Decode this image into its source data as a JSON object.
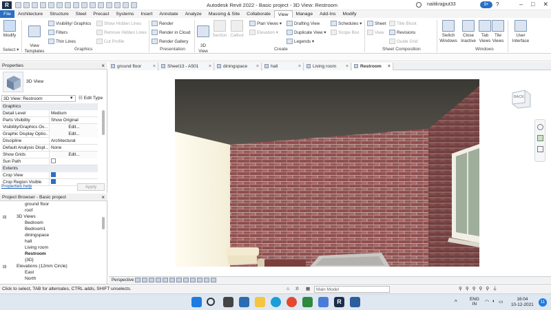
{
  "app": {
    "title": "Autodesk Revit 2022 - Basic project - 3D View: Restroom",
    "user": "naitikrajput33",
    "badge": "9+",
    "logo_letter": "R"
  },
  "ribbon_tabs": [
    "File",
    "Architecture",
    "Structure",
    "Steel",
    "Precast",
    "Systems",
    "Insert",
    "Annotate",
    "Analyze",
    "Massing & Site",
    "Collaborate",
    "View",
    "Manage",
    "Add-Ins",
    "Modify"
  ],
  "active_tab": "View",
  "ribbon": {
    "modify": "Modify",
    "select": "Select ▾",
    "view_templates": "View\nTemplates",
    "visibility_graphics": "Visibility/ Graphics",
    "filters": "Filters",
    "thin_lines": "Thin Lines",
    "show_hidden_lines": "Show Hidden Lines",
    "remove_hidden_lines": "Remove Hidden Lines",
    "cut_profile": "Cut Profile",
    "graphics_label": "Graphics",
    "render": "Render",
    "render_cloud": "Render in Cloud",
    "render_gallery": "Render Gallery",
    "presentation_label": "Presentation",
    "view_3d": "3D\nView",
    "section": "Section",
    "callout": "Callout",
    "plan_views": "Plan Views ▾",
    "elevation": "Elevation ▾",
    "drafting_view": "Drafting View",
    "duplicate_view": "Duplicate View ▾",
    "legends": "Legends ▾",
    "schedules": "Schedules ▾",
    "scope_box": "Scope Box",
    "create_label": "Create",
    "sheet": "Sheet",
    "view": "View",
    "title_block": "Title Block",
    "revisions": "Revisions",
    "guide_grid": "Guide Grid",
    "sheet_composition_label": "Sheet Composition",
    "switch_windows": "Switch\nWindows",
    "close_inactive": "Close\nInactive",
    "tab_views": "Tab\nViews",
    "tile_views": "Tile\nViews",
    "windows_label": "Windows",
    "user_interface": "User\nInterface"
  },
  "properties": {
    "header": "Properties",
    "type_name": "3D View",
    "instance": "3D View: Restroom",
    "edit_type": "Edit Type",
    "graphics_section": "Graphics",
    "rows": [
      {
        "k": "Detail Level",
        "v": "Medium"
      },
      {
        "k": "Parts Visibility",
        "v": "Show Original"
      },
      {
        "k": "Visibility/Graphics Ov...",
        "v": "Edit..."
      },
      {
        "k": "Graphic Display Optio...",
        "v": "Edit..."
      },
      {
        "k": "Discipline",
        "v": "Architectural"
      },
      {
        "k": "Default Analysis Displ...",
        "v": "None"
      },
      {
        "k": "Show Grids",
        "v": "Edit..."
      },
      {
        "k": "Sun Path",
        "v": ""
      }
    ],
    "extents_section": "Extents",
    "extent_rows": [
      {
        "k": "Crop View",
        "v": ""
      },
      {
        "k": "Crop Region Visible",
        "v": ""
      }
    ],
    "help": "Properties help",
    "apply": "Apply"
  },
  "browser": {
    "header": "Project Browser - Basic project",
    "items": [
      {
        "label": "ground floor",
        "indent": 2
      },
      {
        "label": "roof",
        "indent": 2
      },
      {
        "label": "3D Views",
        "indent": 1,
        "toggle": "⊟"
      },
      {
        "label": "Bedroom",
        "indent": 2
      },
      {
        "label": "Bedroom1",
        "indent": 2
      },
      {
        "label": "diningspace",
        "indent": 2
      },
      {
        "label": "hall",
        "indent": 2
      },
      {
        "label": "Living room",
        "indent": 2
      },
      {
        "label": "Restroom",
        "indent": 2,
        "selected": true
      },
      {
        "label": "{3D}",
        "indent": 2
      },
      {
        "label": "Elevations (12mm Circle)",
        "indent": 1,
        "toggle": "⊟"
      },
      {
        "label": "East",
        "indent": 2
      },
      {
        "label": "North",
        "indent": 2
      }
    ]
  },
  "view_tabs": [
    "ground floor",
    "Sheet13 - A501",
    "diningspace",
    "hall",
    "Living room",
    "Restroom"
  ],
  "active_view_tab": "Restroom",
  "viewcube_label": "BACK",
  "view_control": {
    "mode": "Perspective"
  },
  "status": {
    "message": "Click to select, TAB for alternates, CTRL adds, SHIFT unselects.",
    "zero": ":0",
    "model": "Main Model"
  },
  "taskbar": {
    "lang1": "ENG",
    "lang2": "IN",
    "time": "16:04",
    "date": "10-12-2021",
    "notif": "11"
  }
}
